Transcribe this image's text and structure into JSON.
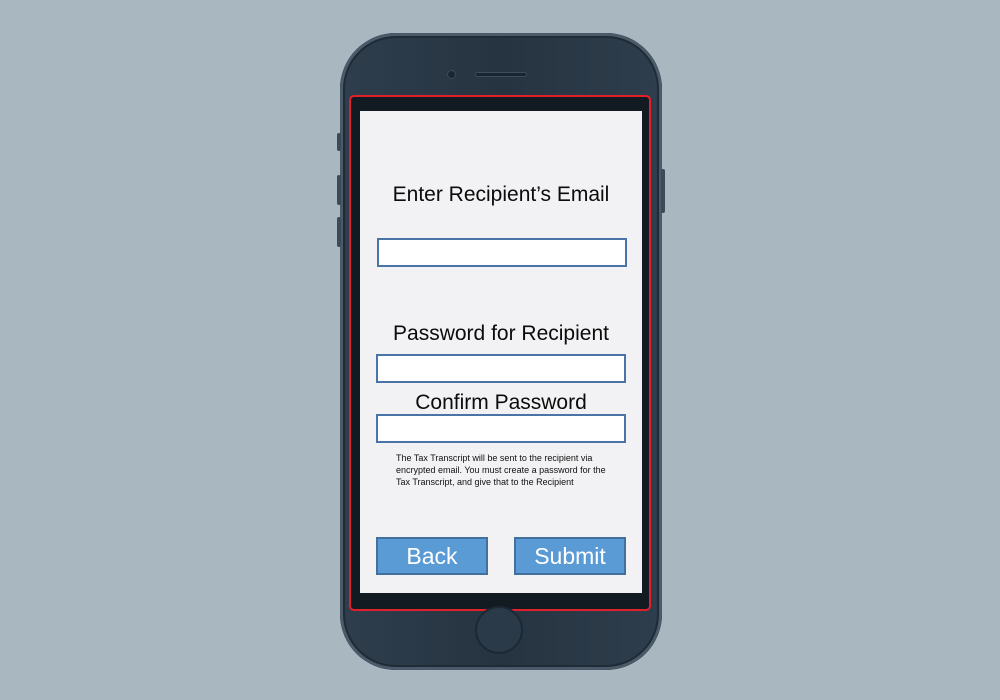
{
  "form": {
    "email_label": "Enter Recipient’s Email",
    "email_value": "",
    "password_label": "Password for Recipient",
    "password_value": "",
    "confirm_label": "Confirm Password",
    "confirm_value": "",
    "note": "The Tax Transcript will be sent to the recipient via encrypted email. You must create a password for the Tax Transcript, and give that to the Recipient"
  },
  "actions": {
    "back_label": "Back",
    "submit_label": "Submit"
  },
  "colors": {
    "background": "#a9b7c1",
    "phone_body": "#263442",
    "screen_border": "#e2202a",
    "screen_bg": "#f2f1f3",
    "field_border": "#4a74a8",
    "button_fill": "#5b9bd5",
    "button_border": "#41719c"
  }
}
